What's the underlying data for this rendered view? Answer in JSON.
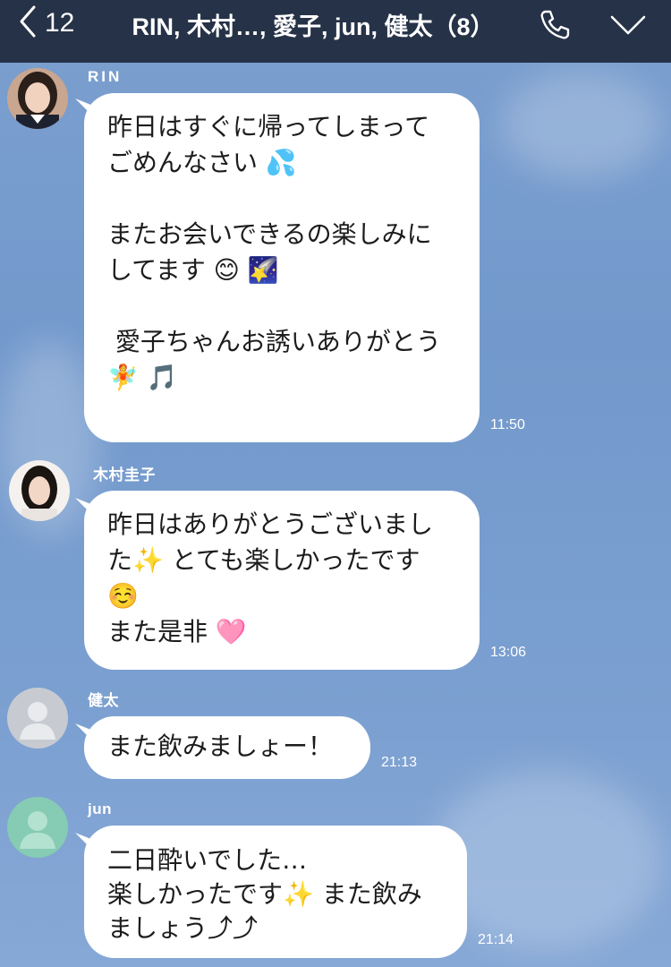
{
  "header": {
    "back_count": "12",
    "title": "RIN, 木村…, 愛子, jun, 健太（8）"
  },
  "messages": [
    {
      "sender": "RIN",
      "text": "昨日はすぐに帰ってしまって\nごめんなさい 💦\n\nまたお会いできるの楽しみに\nしてます 😊 🌠\n\n 愛子ちゃんお誘いありがとう\n🧚 🎵",
      "time": "11:50"
    },
    {
      "sender": "木村圭子",
      "text": "昨日はありがとうございまし\nた✨ とても楽しかったです\n☺️\nまた是非 🩷",
      "time": "13:06"
    },
    {
      "sender": "健太",
      "text": "また飲みましょー！",
      "time": "21:13"
    },
    {
      "sender": "jun",
      "text": "二日酔いでした…\n楽しかったです✨ また飲み\nましょう⤴⤴",
      "time": "21:14"
    }
  ]
}
